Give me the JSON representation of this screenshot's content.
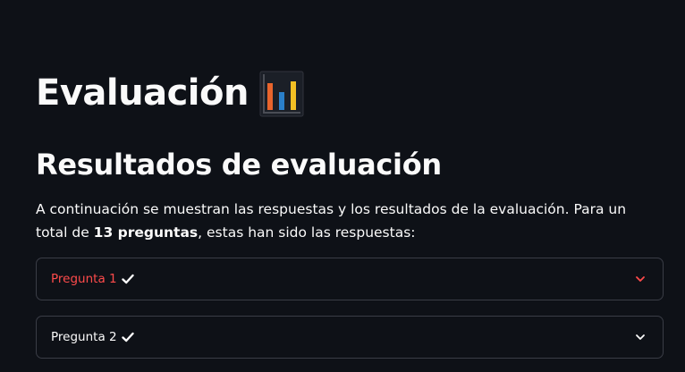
{
  "header": {
    "title": "Evaluación",
    "title_icon": "bar-chart-emoji"
  },
  "section": {
    "title": "Resultados de evaluación",
    "intro_part1": "A continuación se muestran las respuestas y los resultados de la evaluación. Para un total de ",
    "intro_bold": "13 preguntas",
    "intro_part2": ", estas han sido las respuestas:"
  },
  "questions": [
    {
      "label": "Pregunta 1",
      "status_icon": "check-icon",
      "active": true,
      "label_color": "#ff4b4b"
    },
    {
      "label": "Pregunta 2",
      "status_icon": "check-icon",
      "active": false,
      "label_color": "#fafafa"
    }
  ],
  "colors": {
    "background": "#0e1117",
    "text": "#fafafa",
    "accent": "#ff4b4b",
    "border": "#3a3d46"
  }
}
